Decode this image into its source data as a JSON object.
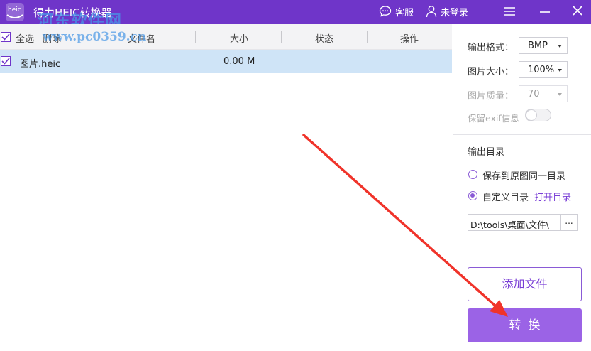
{
  "window": {
    "title": "得力HEIC转换器",
    "logo_text": "heic",
    "watermark_top": "河东软件网",
    "watermark_url": "www.pc0359.cn",
    "customer_service_label": "客服",
    "login_label": "未登录"
  },
  "table": {
    "select_all_label": "全选",
    "delete_label": "删除",
    "columns": [
      "文件名",
      "大小",
      "状态",
      "操作"
    ],
    "rows": [
      {
        "checked": true,
        "filename": "图片.heic",
        "size": "0.00 M",
        "status": "",
        "action": ""
      }
    ]
  },
  "settings": {
    "output_format_label": "输出格式：",
    "output_format_value": "BMP",
    "image_size_label": "图片大小：",
    "image_size_value": "100%",
    "image_quality_label": "图片质量：",
    "image_quality_value": "70",
    "keep_exif_label": "保留exif信息",
    "keep_exif_enabled": false
  },
  "output": {
    "section_title": "输出目录",
    "option_same_dir": "保存到原图同一目录",
    "option_custom_dir": "自定义目录",
    "selected_option": "custom",
    "open_dir_link": "打开目录",
    "path_value": "D:\\tools\\桌面\\文件\\",
    "browse_label": "..."
  },
  "actions": {
    "add_files_label": "添加文件",
    "convert_label": "转换"
  },
  "colors": {
    "titlebar": "#6f35c9",
    "accent": "#8a5ad6",
    "convert_button": "#9b63e6",
    "selected_row": "#cfe4f7",
    "annotation_arrow": "#f0332a"
  }
}
